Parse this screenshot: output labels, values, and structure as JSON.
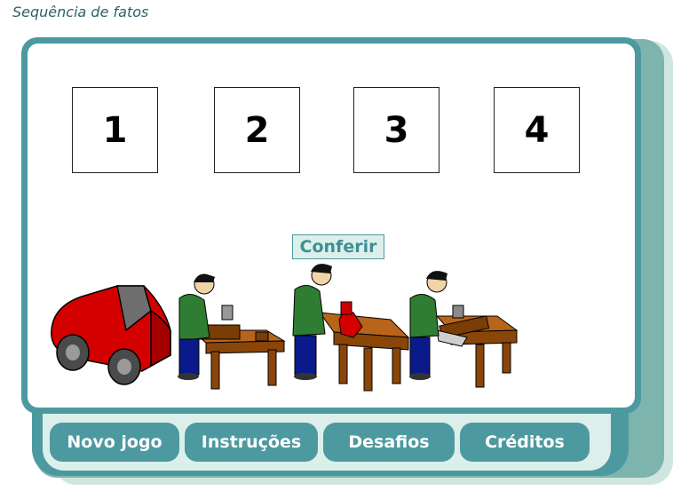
{
  "page_title": "Sequência de fatos",
  "slots": [
    "1",
    "2",
    "3",
    "4"
  ],
  "check_button": "Conferir",
  "menu": {
    "new_game": "Novo jogo",
    "instructions": "Instruções",
    "challenges": "Desafios",
    "credits": "Créditos"
  },
  "colors": {
    "frame": "#4c9aa0",
    "frame_light": "#dcefeb",
    "car": "#d40000",
    "table": "#a0520a",
    "shirt": "#2e7d32"
  },
  "images": [
    "toy-car",
    "carpenter-painting",
    "carpenter-sanding",
    "carpenter-sawing"
  ]
}
